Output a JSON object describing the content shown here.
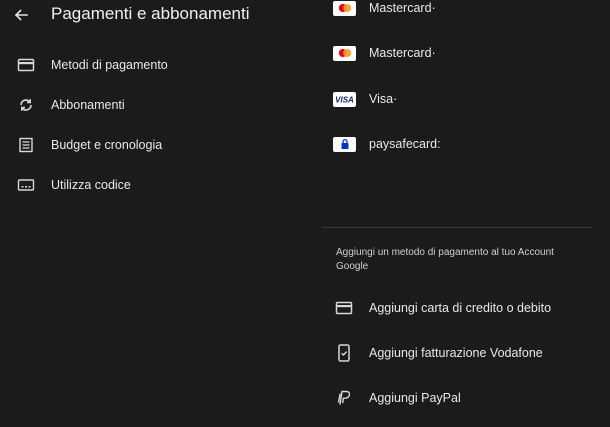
{
  "header": {
    "title": "Pagamenti e abbonamenti",
    "back_icon": "arrow-back-icon"
  },
  "menu": {
    "items": [
      {
        "label": "Metodi di pagamento",
        "icon": "credit-card-icon"
      },
      {
        "label": "Abbonamenti",
        "icon": "sync-icon"
      },
      {
        "label": "Budget e cronologia",
        "icon": "list-icon"
      },
      {
        "label": "Utilizza codice",
        "icon": "redeem-code-icon"
      }
    ]
  },
  "payment_methods": {
    "items": [
      {
        "label": "Mastercard·",
        "brand": "mastercard"
      },
      {
        "label": "Mastercard·",
        "brand": "mastercard"
      },
      {
        "label": "Visa·",
        "brand": "visa"
      },
      {
        "label": "paysafecard:",
        "brand": "paysafecard"
      }
    ]
  },
  "add_section": {
    "caption": "Aggiungi un metodo di pagamento al tuo Account Google",
    "items": [
      {
        "label": "Aggiungi carta di credito o debito",
        "icon": "credit-card-icon"
      },
      {
        "label": "Aggiungi fatturazione Vodafone",
        "icon": "phone-check-icon"
      },
      {
        "label": "Aggiungi PayPal",
        "icon": "paypal-icon"
      }
    ]
  },
  "colors": {
    "background": "#1b1b1b",
    "text": "#e8e8e8",
    "divider": "#3a3a3a",
    "mastercard_red": "#eb001b",
    "mastercard_orange": "#f79e1b",
    "visa_blue": "#1a1f71",
    "paysafe_blue": "#0033cc"
  }
}
